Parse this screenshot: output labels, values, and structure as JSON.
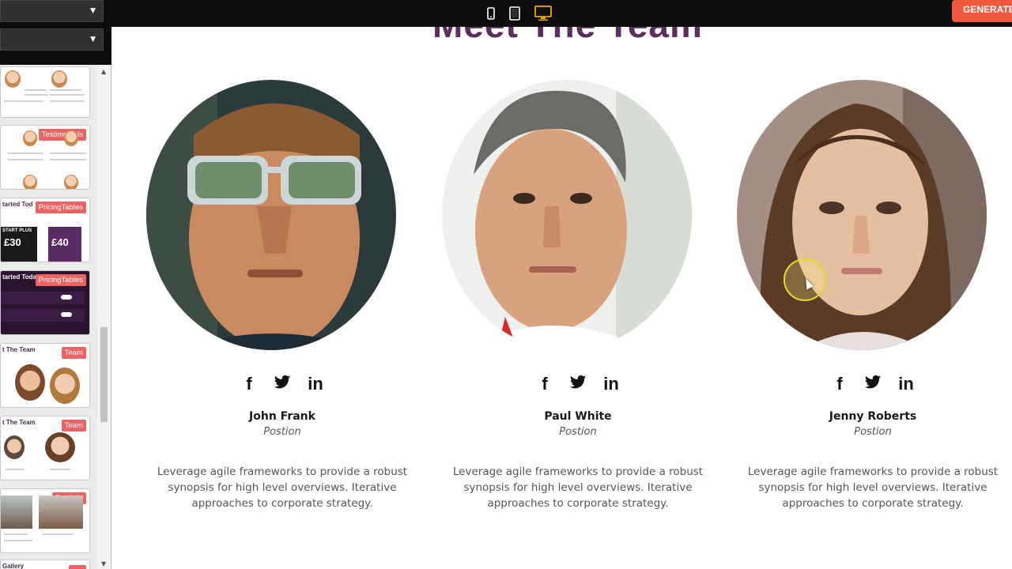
{
  "toolbar": {
    "generate_label": "GENERATE",
    "devices": [
      "mobile-icon",
      "tablet-icon",
      "desktop-icon"
    ],
    "active_device": "desktop",
    "accent_color": "#ef5a3c",
    "active_icon_color": "#f0a500"
  },
  "sidebar": {
    "blocks": [
      {
        "badge": ""
      },
      {
        "badge": "Testimonials"
      },
      {
        "badge": "PricingTables",
        "title": "tarted Tod",
        "prices": [
          "£30",
          "£40"
        ],
        "plan": "START PLUS"
      },
      {
        "badge": "PricingTables",
        "title": "tarted Today"
      },
      {
        "badge": "Team",
        "title": "t The Team"
      },
      {
        "badge": "Team",
        "title": "t The Team"
      },
      {
        "badge": "Portfolio"
      },
      {
        "badge": "",
        "title": "Gallery"
      }
    ]
  },
  "main": {
    "heading": "Meet The Team",
    "heading_color": "#5c2d5e",
    "members": [
      {
        "name": "John Frank",
        "position": "Postion",
        "description": "Leverage agile frameworks to provide a robust synopsis for high level overviews. Iterative approaches to corporate strategy.",
        "socials": {
          "facebook": "f",
          "twitter": "🐦",
          "linkedin": "in"
        }
      },
      {
        "name": "Paul White",
        "position": "Postion",
        "description": "Leverage agile frameworks to provide a robust synopsis for high level overviews. Iterative approaches to corporate strategy.",
        "socials": {
          "facebook": "f",
          "twitter": "🐦",
          "linkedin": "in"
        }
      },
      {
        "name": "Jenny Roberts",
        "position": "Postion",
        "description": "Leverage agile frameworks to provide a robust synopsis for high level overviews. Iterative approaches to corporate strategy.",
        "socials": {
          "facebook": "f",
          "twitter": "🐦",
          "linkedin": "in"
        }
      }
    ]
  }
}
